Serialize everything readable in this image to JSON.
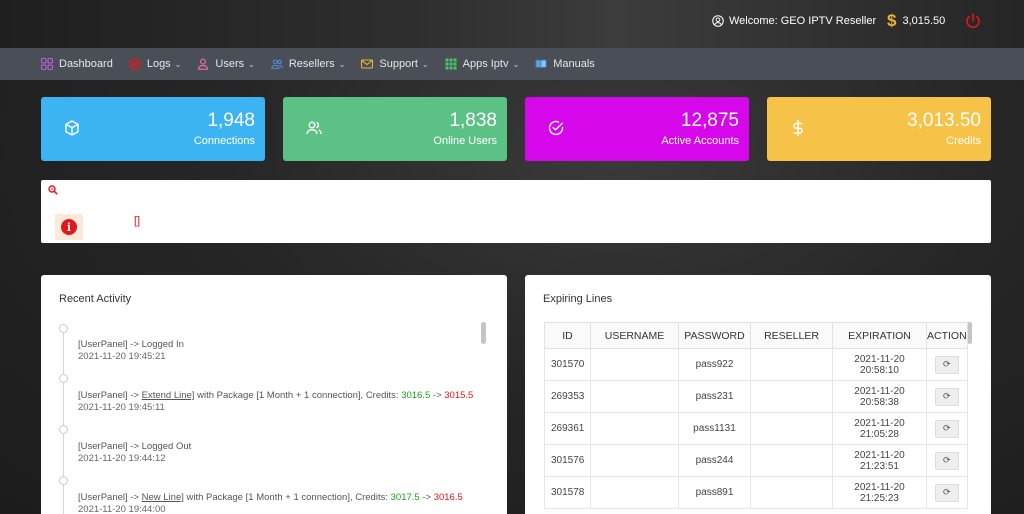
{
  "header": {
    "welcome_text": "Welcome: GEO IPTV Reseller",
    "balance": "3,015.50"
  },
  "nav": {
    "items": [
      {
        "label": "Dashboard",
        "icon": "dashboard-icon",
        "dropdown": false
      },
      {
        "label": "Logs",
        "icon": "globe-icon",
        "dropdown": true
      },
      {
        "label": "Users",
        "icon": "user-icon",
        "dropdown": true
      },
      {
        "label": "Resellers",
        "icon": "users-icon",
        "dropdown": true
      },
      {
        "label": "Support",
        "icon": "envelope-icon",
        "dropdown": true
      },
      {
        "label": "Apps Iptv",
        "icon": "grid-icon",
        "dropdown": true
      },
      {
        "label": "Manuals",
        "icon": "book-icon",
        "dropdown": false
      }
    ]
  },
  "stats": [
    {
      "value": "1,948",
      "label": "Connections",
      "color": "#3db4f2",
      "icon": "cube-icon"
    },
    {
      "value": "1,838",
      "label": "Online Users",
      "color": "#5cc185",
      "icon": "users-icon"
    },
    {
      "value": "12,875",
      "label": "Active Accounts",
      "color": "#d707ec",
      "icon": "check-circle-icon"
    },
    {
      "value": "3,013.50",
      "label": "Credits",
      "color": "#f6c248",
      "icon": "dollar-icon"
    }
  ],
  "notice": {
    "bracket_text": "[]"
  },
  "recent_activity": {
    "title": "Recent Activity",
    "entries": [
      {
        "prefix": "[UserPanel] -> Logged In",
        "time": "2021-11-20 19:45:21"
      },
      {
        "prefix": "[UserPanel] -> ",
        "link": "Extend Line]",
        "middle": " with Package [1 Month + 1 connection], Credits: ",
        "from": "3016.5",
        "arrow": " -> ",
        "to": "3015.5",
        "time": "2021-11-20 19:45:11"
      },
      {
        "prefix": "[UserPanel] -> Logged Out",
        "time": "2021-11-20 19:44:12"
      },
      {
        "prefix": "[UserPanel] -> ",
        "link": "New Line]",
        "middle": " with Package [1 Month + 1 connection], Credits: ",
        "from": "3017.5",
        "arrow": " -> ",
        "to": "3016.5",
        "time": "2021-11-20 19:44:00"
      }
    ]
  },
  "expiring_lines": {
    "title": "Expiring Lines",
    "columns": [
      "ID",
      "USERNAME",
      "PASSWORD",
      "RESELLER",
      "EXPIRATION",
      "ACTION"
    ],
    "rows": [
      {
        "id": "301570",
        "username": "",
        "password": "pass922",
        "reseller": "",
        "date": "2021-11-20",
        "time": "20:58:10"
      },
      {
        "id": "269353",
        "username": "",
        "password": "pass231",
        "reseller": "",
        "date": "2021-11-20",
        "time": "20:58:38"
      },
      {
        "id": "269361",
        "username": "",
        "password": "pass1131",
        "reseller": "",
        "date": "2021-11-20",
        "time": "21:05:28"
      },
      {
        "id": "301576",
        "username": "",
        "password": "pass244",
        "reseller": "",
        "date": "2021-11-20",
        "time": "21:23:51"
      },
      {
        "id": "301578",
        "username": "",
        "password": "pass891",
        "reseller": "",
        "date": "2021-11-20",
        "time": "21:25:23"
      }
    ]
  }
}
